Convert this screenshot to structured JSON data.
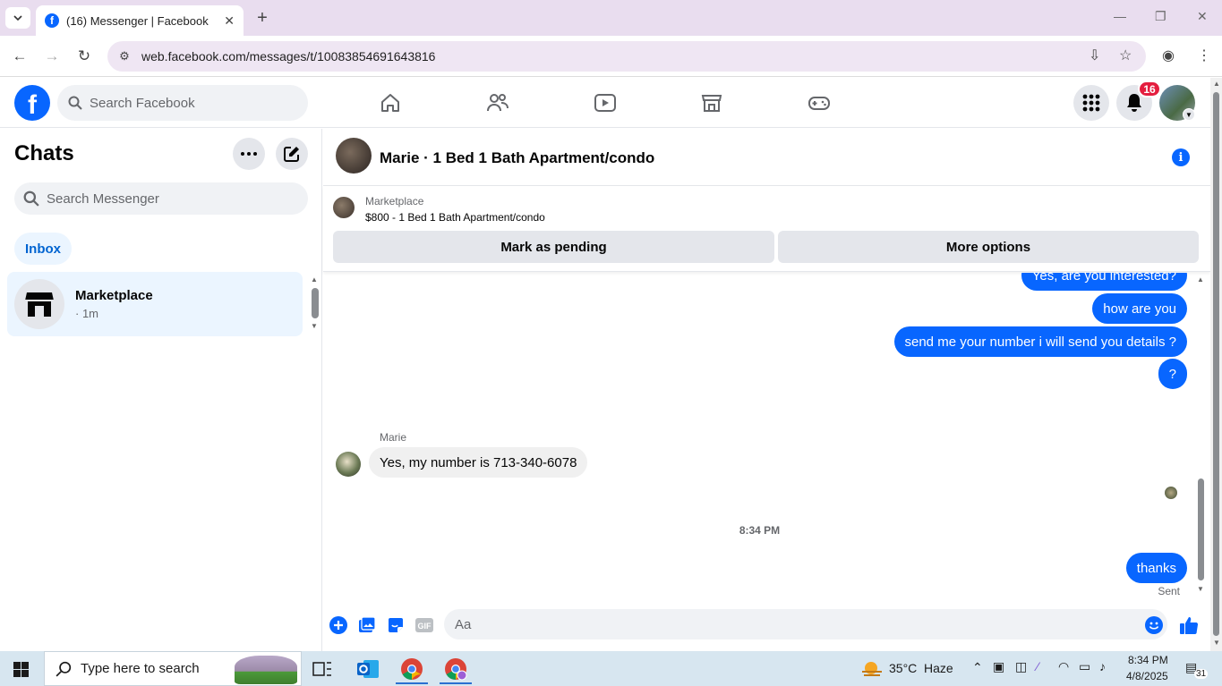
{
  "browser": {
    "tab_title": "(16) Messenger | Facebook",
    "tab_favicon": "f",
    "url": "web.facebook.com/messages/t/10083854691643816"
  },
  "fb_header": {
    "search_placeholder": "Search Facebook",
    "notification_count": "16"
  },
  "left_panel": {
    "title": "Chats",
    "search_placeholder": "Search Messenger",
    "filter_pill": "Inbox",
    "chats": [
      {
        "name": "Marketplace",
        "time": "· 1m"
      }
    ]
  },
  "conversation": {
    "title": "Marie · 1 Bed 1 Bath Apartment/condo",
    "marketplace_label": "Marketplace",
    "listing": "$800 - 1 Bed 1 Bath Apartment/condo",
    "mark_pending_label": "Mark as pending",
    "more_options_label": "More options",
    "messages": {
      "out_1": "Yes, are you interested?",
      "out_2": "how are you",
      "out_3": "send me your number i will send you details ?",
      "out_4": "?",
      "sender_name": "Marie",
      "in_1": "Yes, my number is 713-340-6078",
      "timestamp": "8:34 PM",
      "out_5": "thanks",
      "status": "Sent"
    },
    "composer_placeholder": "Aa"
  },
  "taskbar": {
    "search_placeholder": "Type here to search",
    "weather_temp": "35°C",
    "weather_desc": "Haze",
    "time": "8:34 PM",
    "date": "4/8/2025",
    "notification_count": "31"
  },
  "colors": {
    "accent": "#0866ff",
    "badge": "#e41e3f",
    "selected_bg": "#ebf5ff"
  }
}
